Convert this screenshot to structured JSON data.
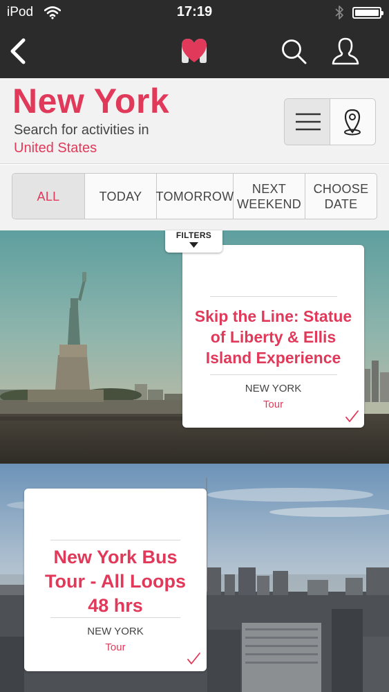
{
  "status_bar": {
    "carrier": "iPod",
    "time": "17:19"
  },
  "nav": {
    "back_icon": "chevron-left-icon",
    "logo_icon": "heart-logo-icon",
    "search_icon": "search-icon",
    "account_icon": "user-icon"
  },
  "header": {
    "city": "New York",
    "subtitle": "Search for activities in",
    "country": "United States",
    "view_list_icon": "list-icon",
    "view_map_icon": "map-pin-icon"
  },
  "date_filter": {
    "options": [
      {
        "line1": "ALL",
        "line2": ""
      },
      {
        "line1": "TODAY",
        "line2": ""
      },
      {
        "line1": "TOMORROW",
        "line2": ""
      },
      {
        "line1": "NEXT",
        "line2": "WEEKEND"
      },
      {
        "line1": "CHOOSE",
        "line2": "DATE"
      }
    ],
    "selected": "ALL"
  },
  "filters_tab": {
    "label": "FILTERS"
  },
  "activities": [
    {
      "title": "Skip the Line: Statue of Liberty & Ellis Island Experience",
      "location": "NEW YORK",
      "category": "Tour",
      "selected": true
    },
    {
      "title": "New York Bus Tour - All Loops 48 hrs",
      "location": "NEW YORK",
      "category": "Tour",
      "selected": true
    }
  ],
  "colors": {
    "accent": "#e0395a",
    "bar": "#2b2b2b",
    "header_bg": "#f2f2f2"
  }
}
